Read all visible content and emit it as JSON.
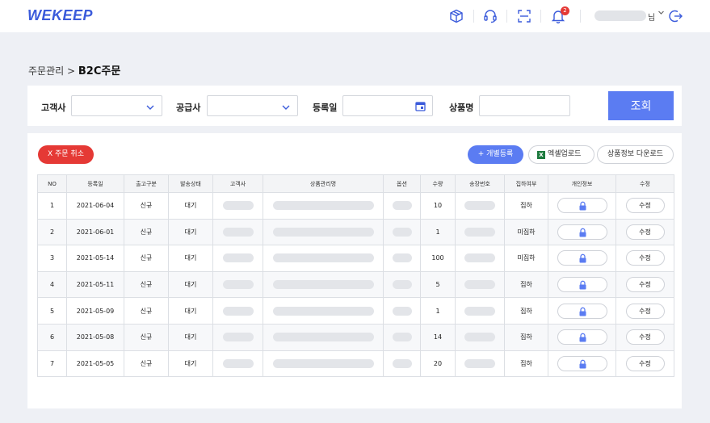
{
  "header": {
    "logo": "WEKEEP",
    "notification_count": "2",
    "user_suffix": "님",
    "icons": [
      "box-icon",
      "headset-icon",
      "scan-icon",
      "bell-icon",
      "logout-icon"
    ]
  },
  "breadcrumb": {
    "parent": "주문관리 >",
    "current": "B2C주문"
  },
  "filter": {
    "customer_label": "고객사",
    "supplier_label": "공급사",
    "regdate_label": "등록일",
    "product_label": "상품명",
    "search_button": "조회"
  },
  "actions": {
    "cancel_order": "X 주문 취소",
    "add_single": "+ 개별등록",
    "excel_upload": "엑셀업로드",
    "excel_icon": "X",
    "product_download": "상품정보 다운로드"
  },
  "table": {
    "columns": [
      "NO",
      "등록일",
      "출고구분",
      "발송상태",
      "고객사",
      "상품관리명",
      "옵션",
      "수량",
      "송장번호",
      "집하여부",
      "개인정보",
      "수정"
    ],
    "edit_label": "수정",
    "rows": [
      {
        "no": "1",
        "date": "2021-06-04",
        "type": "신규",
        "status": "대기",
        "qty": "10",
        "pickup": "집하"
      },
      {
        "no": "2",
        "date": "2021-06-01",
        "type": "신규",
        "status": "대기",
        "qty": "1",
        "pickup": "미집하"
      },
      {
        "no": "3",
        "date": "2021-05-14",
        "type": "신규",
        "status": "대기",
        "qty": "100",
        "pickup": "미집하"
      },
      {
        "no": "4",
        "date": "2021-05-11",
        "type": "신규",
        "status": "대기",
        "qty": "5",
        "pickup": "집하"
      },
      {
        "no": "5",
        "date": "2021-05-09",
        "type": "신규",
        "status": "대기",
        "qty": "1",
        "pickup": "집하"
      },
      {
        "no": "6",
        "date": "2021-05-08",
        "type": "신규",
        "status": "대기",
        "qty": "14",
        "pickup": "집하"
      },
      {
        "no": "7",
        "date": "2021-05-05",
        "type": "신규",
        "status": "대기",
        "qty": "20",
        "pickup": "집하"
      }
    ]
  },
  "colors": {
    "accent": "#5b7cf2",
    "danger": "#e53935",
    "excel": "#1d7a3e"
  }
}
